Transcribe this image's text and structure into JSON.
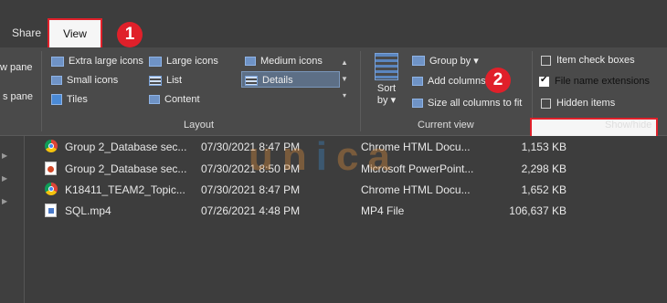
{
  "tabs": {
    "share": "Share",
    "view": "View"
  },
  "steps": {
    "one": "1",
    "two": "2"
  },
  "ribbon": {
    "panes": {
      "preview": "w pane",
      "details": "s pane"
    },
    "layout": {
      "extra_large_icons": "Extra large icons",
      "large_icons": "Large icons",
      "medium_icons": "Medium icons",
      "small_icons": "Small icons",
      "list": "List",
      "details": "Details",
      "tiles": "Tiles",
      "content": "Content",
      "group_label": "Layout"
    },
    "current_view": {
      "sort_by_line1": "Sort",
      "sort_by_line2": "by",
      "group_by": "Group by",
      "add_columns": "Add columns",
      "size_all_columns": "Size all columns to fit",
      "group_label": "Current view"
    },
    "show_hide": {
      "item_check_boxes": "Item check boxes",
      "file_name_extensions": "File name extensions",
      "hidden_items": "Hidden items",
      "group_label": "Show/hide"
    }
  },
  "watermark": {
    "part1": "un",
    "part2": "i",
    "part3": "ca"
  },
  "files": [
    {
      "icon": "chrome-icon",
      "name": "Group 2_Database sec...",
      "date": "07/30/2021 8:47 PM",
      "type": "Chrome HTML Docu...",
      "size": "1,153 KB"
    },
    {
      "icon": "powerpoint-icon",
      "name": "Group 2_Database sec...",
      "date": "07/30/2021 8:50 PM",
      "type": "Microsoft PowerPoint...",
      "size": "2,298 KB"
    },
    {
      "icon": "chrome-icon",
      "name": "K18411_TEAM2_Topic...",
      "date": "07/30/2021 8:47 PM",
      "type": "Chrome HTML Docu...",
      "size": "1,652 KB"
    },
    {
      "icon": "mp4-icon",
      "name": "SQL.mp4",
      "date": "07/26/2021 4:48 PM",
      "type": "MP4 File",
      "size": "106,637 KB"
    }
  ],
  "colors": {
    "highlight_red": "#e0202a",
    "ribbon_bg": "#4a4a4a",
    "window_bg": "#3d3d3d"
  }
}
